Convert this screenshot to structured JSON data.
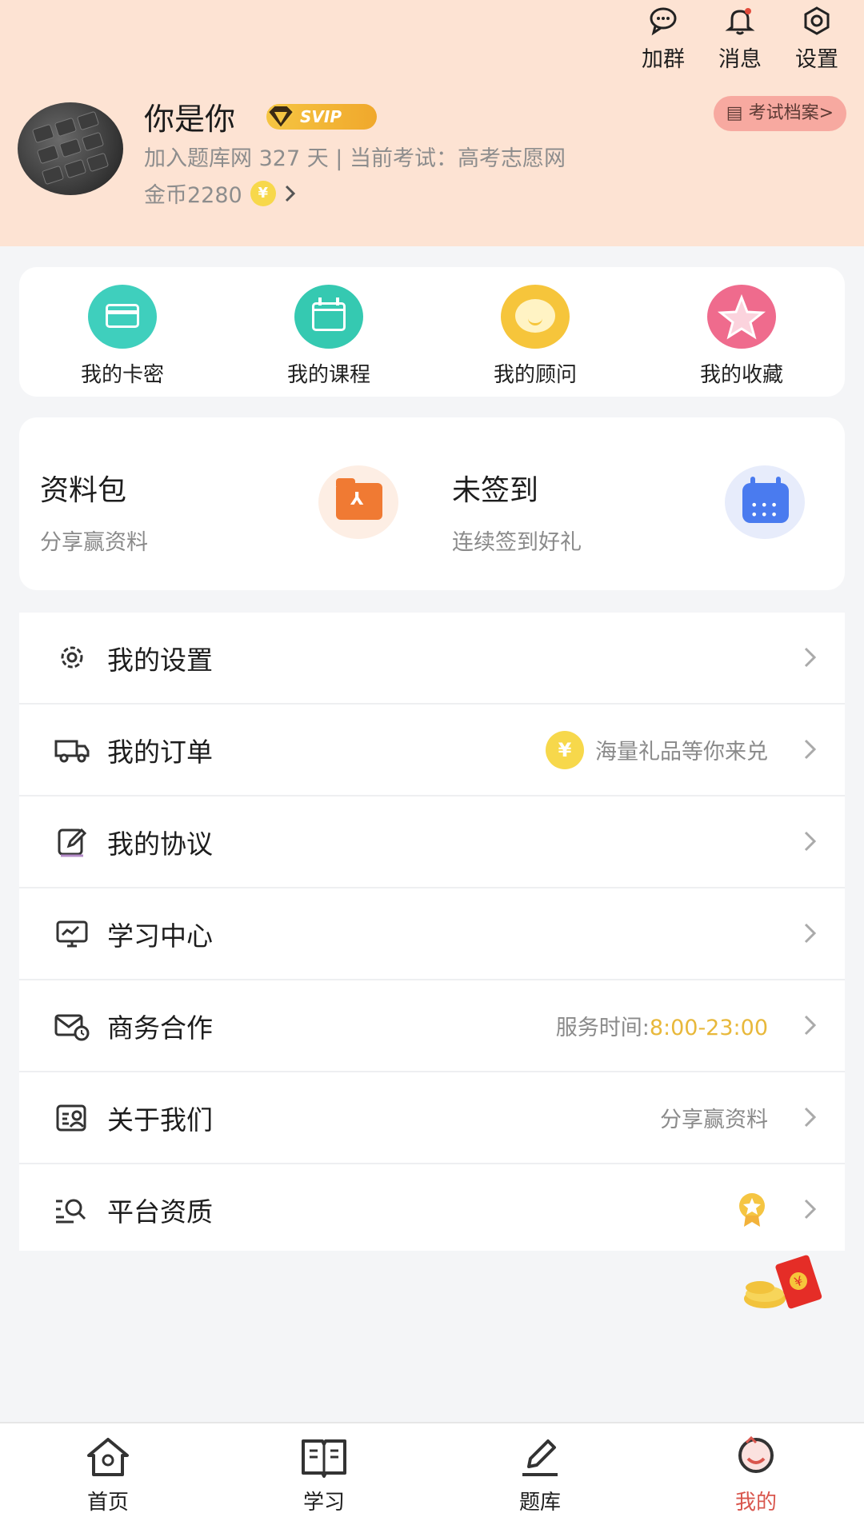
{
  "top_actions": [
    {
      "label": "加群",
      "icon": "chat-group-icon"
    },
    {
      "label": "消息",
      "icon": "bell-icon"
    },
    {
      "label": "设置",
      "icon": "gear-icon"
    }
  ],
  "profile": {
    "username": "你是你",
    "vip_badge": "SVIP",
    "meta": "加入题库网 327 天 | 当前考试：高考志愿网",
    "coins": "金币2280",
    "coin_symbol": "¥",
    "exam_file_button": "考试档案>"
  },
  "quick_actions": [
    {
      "label": "我的卡密",
      "icon": "card-icon",
      "color": "#3fcfbd"
    },
    {
      "label": "我的课程",
      "icon": "calendar-icon",
      "color": "#35c9b1"
    },
    {
      "label": "我的顾问",
      "icon": "chat-bubble-icon",
      "color": "#f6c53b"
    },
    {
      "label": "我的收藏",
      "icon": "star-icon",
      "color": "#ef6b8d"
    }
  ],
  "promo": {
    "materials_title": "资料包",
    "materials_sub": "分享赢资料",
    "checkin_title": "未签到",
    "checkin_sub": "连续签到好礼"
  },
  "menu": [
    {
      "label": "我的设置",
      "icon": "gear-icon",
      "extra": ""
    },
    {
      "label": "我的订单",
      "icon": "truck-icon",
      "extra": "海量礼品等你来兑"
    },
    {
      "label": "我的协议",
      "icon": "edit-icon",
      "extra": ""
    },
    {
      "label": "学习中心",
      "icon": "monitor-icon",
      "extra": ""
    },
    {
      "label": "商务合作",
      "icon": "mail-clock-icon",
      "extra_prefix": "服务时间:",
      "extra_accent": "8:00-23:00"
    },
    {
      "label": "关于我们",
      "icon": "contact-icon",
      "extra": "分享赢资料"
    },
    {
      "label": "平台资质",
      "icon": "search-list-icon",
      "extra": ""
    }
  ],
  "tabbar": [
    {
      "label": "首页",
      "icon": "home-icon"
    },
    {
      "label": "学习",
      "icon": "book-icon"
    },
    {
      "label": "题库",
      "icon": "pen-icon"
    },
    {
      "label": "我的",
      "icon": "profile-icon",
      "active": true
    }
  ],
  "colors": {
    "header_bg": "#fde3d3",
    "accent": "#d9564d",
    "gold": "#e8b83a"
  }
}
